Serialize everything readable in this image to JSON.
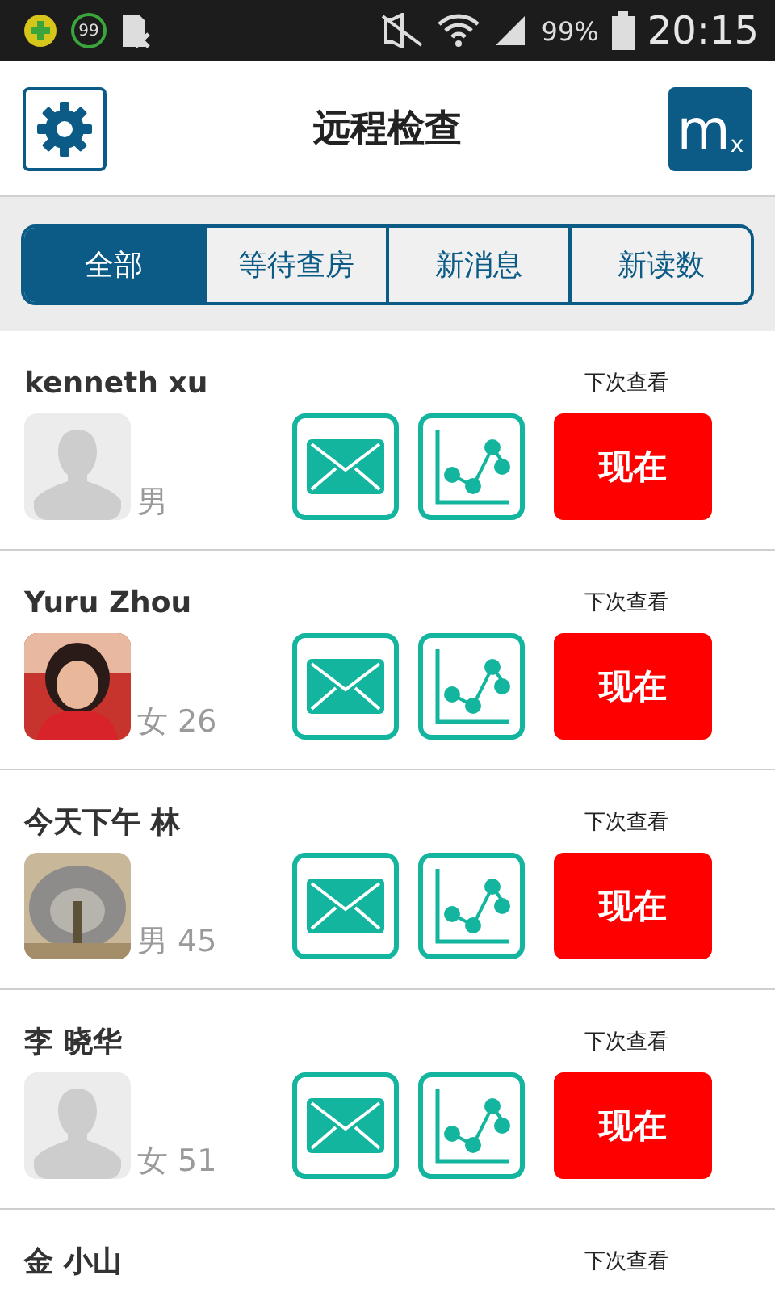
{
  "status_bar": {
    "badge": "99",
    "battery": "99%",
    "time": "20:15"
  },
  "header": {
    "title": "远程检查",
    "logo": "m",
    "logo_sub": "x"
  },
  "tabs": [
    {
      "label": "全部",
      "selected": true
    },
    {
      "label": "等待查房",
      "selected": false
    },
    {
      "label": "新消息",
      "selected": false
    },
    {
      "label": "新读数",
      "selected": false
    }
  ],
  "patients": [
    {
      "name": "kenneth xu",
      "avatar": {
        "kind": "silhouette"
      },
      "info": "男",
      "next_label": "下次查看",
      "action": "现在"
    },
    {
      "name": "Yuru Zhou",
      "info": "女 26",
      "next_label": "下次查看",
      "action": "现在"
    },
    {
      "name": "今天下午 林",
      "info": "男 45",
      "next_label": "下次查看",
      "action": "现在"
    },
    {
      "name": "李 晓华",
      "avatar": {
        "kind": "silhouette"
      },
      "info": "女 51",
      "next_label": "下次查看",
      "action": "现在"
    }
  ],
  "partial_patient": {
    "name": "金 小山",
    "next_label": "下次查看"
  }
}
